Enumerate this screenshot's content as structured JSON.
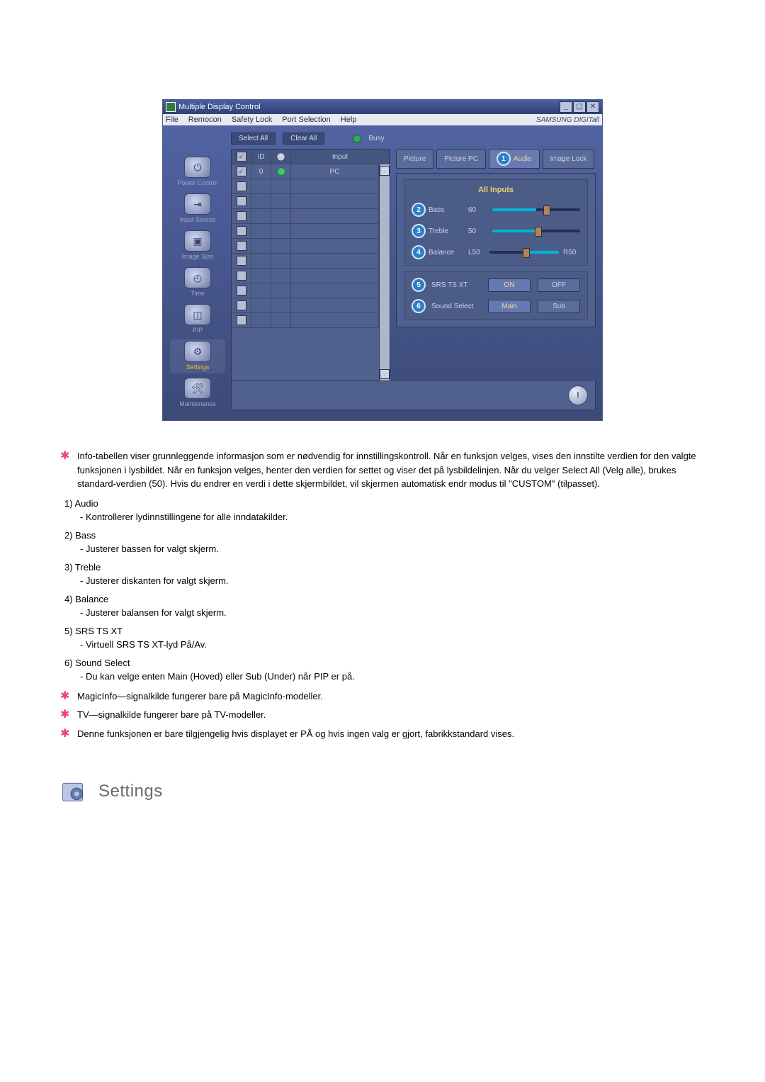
{
  "app": {
    "title": "Multiple Display Control",
    "menu": [
      "File",
      "Remocon",
      "Safety Lock",
      "Port Selection",
      "Help"
    ],
    "brand": "SAMSUNG DIGITall"
  },
  "toolbar": {
    "select_all": "Select All",
    "clear_all": "Clear All",
    "busy": "Busy"
  },
  "sidebar": {
    "items": [
      {
        "label": "Power Control"
      },
      {
        "label": "Input Source"
      },
      {
        "label": "Image Size"
      },
      {
        "label": "Time"
      },
      {
        "label": "PIP"
      },
      {
        "label": "Settings"
      },
      {
        "label": "Maintenance"
      }
    ]
  },
  "grid": {
    "headers": {
      "check": "",
      "id": "ID",
      "status": "",
      "input": "Input"
    },
    "rows": [
      {
        "checked": true,
        "id": "0",
        "status": "on",
        "input": "PC"
      },
      {
        "checked": false,
        "id": "",
        "status": "",
        "input": ""
      },
      {
        "checked": false,
        "id": "",
        "status": "",
        "input": ""
      },
      {
        "checked": false,
        "id": "",
        "status": "",
        "input": ""
      },
      {
        "checked": false,
        "id": "",
        "status": "",
        "input": ""
      },
      {
        "checked": false,
        "id": "",
        "status": "",
        "input": ""
      },
      {
        "checked": false,
        "id": "",
        "status": "",
        "input": ""
      },
      {
        "checked": false,
        "id": "",
        "status": "",
        "input": ""
      },
      {
        "checked": false,
        "id": "",
        "status": "",
        "input": ""
      },
      {
        "checked": false,
        "id": "",
        "status": "",
        "input": ""
      },
      {
        "checked": false,
        "id": "",
        "status": "",
        "input": ""
      }
    ]
  },
  "tabs": {
    "picture": "Picture",
    "picture_pc": "Picture PC",
    "audio": "Audio",
    "image_lock": "Image Lock"
  },
  "panel": {
    "all_inputs": "All Inputs",
    "bass_label": "Bass",
    "bass_value": "60",
    "treble_label": "Treble",
    "treble_value": "50",
    "balance_label": "Balance",
    "balance_left": "L50",
    "balance_right": "R50",
    "srs_label": "SRS TS XT",
    "on": "ON",
    "off": "OFF",
    "sound_select_label": "Sound Select",
    "main": "Main",
    "sub": "Sub"
  },
  "badges": {
    "b1": "1",
    "b2": "2",
    "b3": "3",
    "b4": "4",
    "b5": "5",
    "b6": "6"
  },
  "notes": {
    "intro": "Info-tabellen viser grunnleggende informasjon som er nødvendig for innstillingskontroll. Når en funksjon velges, vises den innstilte verdien for den valgte funksjonen i lysbildet. Når en funksjon velges, henter den verdien for settet og viser det på lysbildelinjen. Når du velger Select All (Velg alle), brukes standard-verdien (50). Hvis du endrer en verdi i dette skjermbildet, vil skjermen automatisk endr modus til \"CUSTOM\" (tilpasset).",
    "items": [
      {
        "n": "1)",
        "t": "Audio",
        "d": "- Kontrollerer lydinnstillingene for alle inndatakilder."
      },
      {
        "n": "2)",
        "t": "Bass",
        "d": "- Justerer bassen for valgt skjerm."
      },
      {
        "n": "3)",
        "t": "Treble",
        "d": "- Justerer diskanten for valgt skjerm."
      },
      {
        "n": "4)",
        "t": "Balance",
        "d": "- Justerer balansen for valgt skjerm."
      },
      {
        "n": "5)",
        "t": "SRS TS XT",
        "d": "- Virtuell SRS TS XT-lyd På/Av."
      },
      {
        "n": "6)",
        "t": "Sound Select",
        "d": "- Du kan velge enten Main (Hoved) eller Sub (Under) når PIP er på."
      }
    ],
    "footnotes": [
      "MagicInfo—signalkilde fungerer bare på MagicInfo-modeller.",
      "TV—signalkilde fungerer bare på TV-modeller.",
      "Denne funksjonen er bare tilgjengelig hvis displayet er PÅ og hvis ingen valg er gjort, fabrikkstandard vises."
    ]
  },
  "settings_section": {
    "title": "Settings"
  }
}
